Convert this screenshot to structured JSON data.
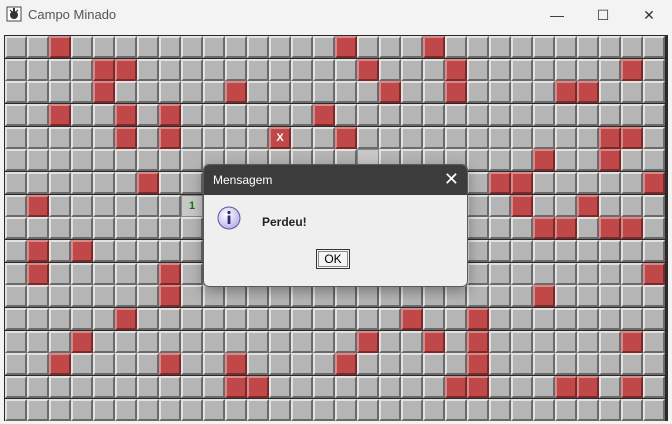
{
  "window": {
    "title": "Campo Minado",
    "icon": "minesweeper-app-icon",
    "min_glyph": "—",
    "max_glyph": "☐",
    "close_glyph": "✕"
  },
  "board": {
    "cols": 30,
    "rows": 17,
    "cell_colors": {
      "hidden": "#b5b5b5",
      "mine": "#c04848"
    },
    "mines": [
      [
        0,
        2
      ],
      [
        0,
        15
      ],
      [
        0,
        19
      ],
      [
        1,
        4
      ],
      [
        1,
        5
      ],
      [
        1,
        16
      ],
      [
        1,
        20
      ],
      [
        1,
        28
      ],
      [
        2,
        4
      ],
      [
        2,
        10
      ],
      [
        2,
        17
      ],
      [
        2,
        20
      ],
      [
        2,
        25
      ],
      [
        2,
        26
      ],
      [
        3,
        2
      ],
      [
        3,
        5
      ],
      [
        3,
        7
      ],
      [
        3,
        14
      ],
      [
        4,
        5
      ],
      [
        4,
        7
      ],
      [
        4,
        15
      ],
      [
        4,
        27
      ],
      [
        4,
        28
      ],
      [
        5,
        24
      ],
      [
        5,
        27
      ],
      [
        6,
        6
      ],
      [
        6,
        22
      ],
      [
        6,
        23
      ],
      [
        6,
        29
      ],
      [
        7,
        1
      ],
      [
        7,
        23
      ],
      [
        7,
        26
      ],
      [
        8,
        24
      ],
      [
        8,
        25
      ],
      [
        8,
        27
      ],
      [
        8,
        28
      ],
      [
        9,
        1
      ],
      [
        9,
        3
      ],
      [
        10,
        1
      ],
      [
        10,
        7
      ],
      [
        10,
        29
      ],
      [
        11,
        7
      ],
      [
        11,
        24
      ],
      [
        12,
        5
      ],
      [
        12,
        18
      ],
      [
        12,
        21
      ],
      [
        13,
        3
      ],
      [
        13,
        16
      ],
      [
        13,
        19
      ],
      [
        13,
        21
      ],
      [
        13,
        28
      ],
      [
        14,
        2
      ],
      [
        14,
        7
      ],
      [
        14,
        10
      ],
      [
        14,
        15
      ],
      [
        14,
        21
      ],
      [
        15,
        10
      ],
      [
        15,
        11
      ],
      [
        15,
        20
      ],
      [
        15,
        21
      ],
      [
        15,
        25
      ],
      [
        15,
        26
      ],
      [
        15,
        28
      ]
    ],
    "revealed": [
      [
        5,
        16
      ]
    ],
    "exploded": {
      "r": 4,
      "c": 12,
      "label": "X"
    },
    "numbers": [
      {
        "r": 7,
        "c": 8,
        "label": "1"
      }
    ]
  },
  "dialog": {
    "title": "Mensagem",
    "close_glyph": "✕",
    "icon": "info-icon",
    "message": "Perdeu!",
    "ok_label": "OK"
  }
}
